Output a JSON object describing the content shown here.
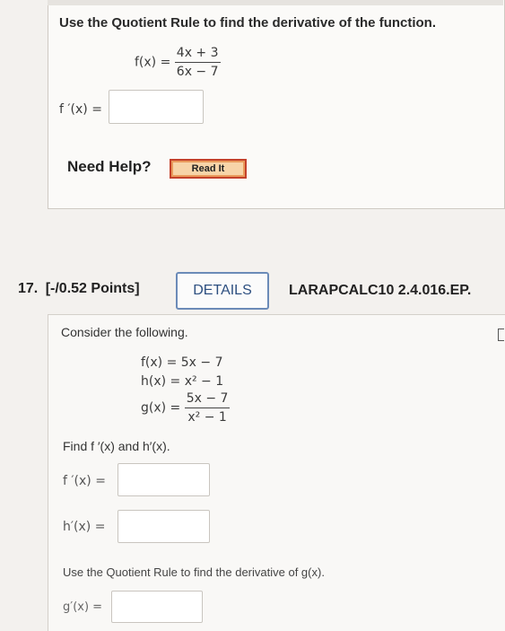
{
  "question16": {
    "prompt": "Use the Quotient Rule to find the derivative of the function.",
    "function_lhs": "f(x) =",
    "function_numerator": "4x + 3",
    "function_denominator": "6x − 7",
    "answer_label": "f ′(x) =",
    "answer_value": "",
    "need_help": "Need Help?",
    "read_it": "Read It"
  },
  "question17": {
    "number": "17.",
    "points": "[-/0.52 Points]",
    "details_label": "DETAILS",
    "problem_id": "LARAPCALC10 2.4.016.EP.",
    "consider": "Consider the following.",
    "f_def": "f(x) = 5x − 7",
    "h_def": "h(x) = x² − 1",
    "g_lhs": "g(x) =",
    "g_numerator": "5x − 7",
    "g_denominator": "x² − 1",
    "find_prompt": "Find f ′(x) and h′(x).",
    "f_prime_label": "f ′(x) =",
    "f_prime_value": "",
    "h_prime_label": "h′(x) =",
    "h_prime_value": "",
    "quotient_prompt": "Use the Quotient Rule to find the derivative of g(x).",
    "g_prime_label": "g′(x) =",
    "g_prime_value": ""
  }
}
